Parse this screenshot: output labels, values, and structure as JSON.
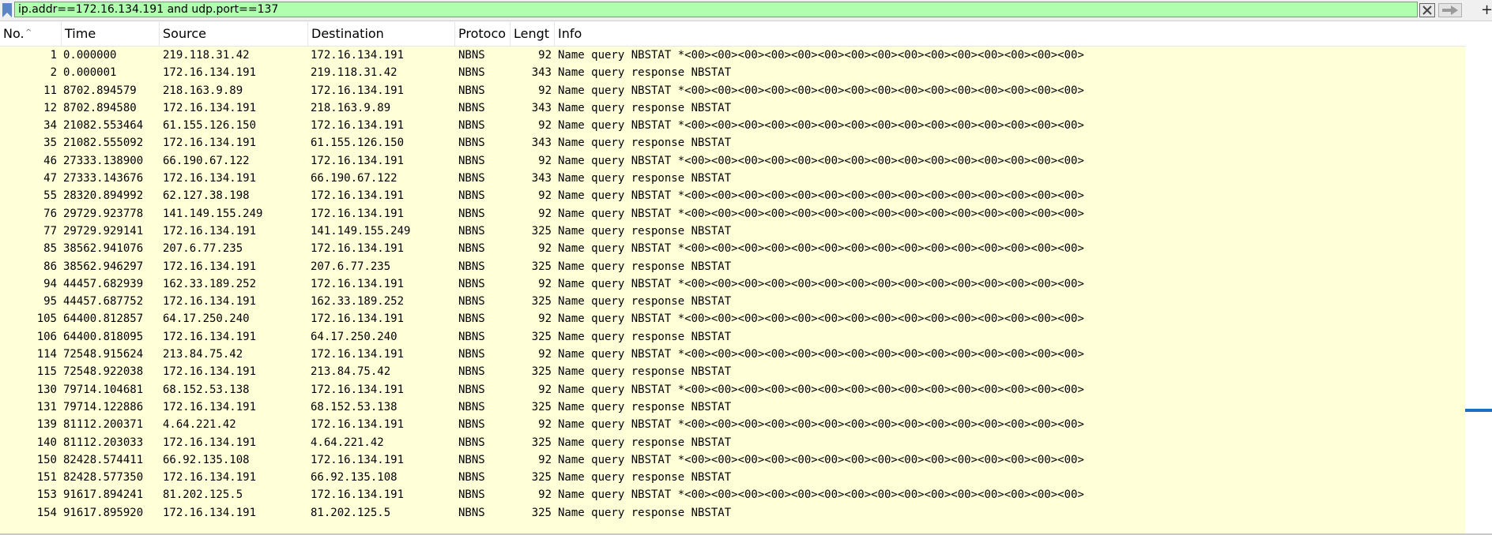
{
  "filter": {
    "value": "ip.addr==172.16.134.191 and udp.port==137",
    "plus_label": "+"
  },
  "columns": {
    "no": "No.",
    "time": "Time",
    "source": "Source",
    "destination": "Destination",
    "protocol": "Protoco",
    "length": "Lengt",
    "info": "Info"
  },
  "packets": [
    {
      "no": "1",
      "time": "0.000000",
      "src": "219.118.31.42",
      "dst": "172.16.134.191",
      "proto": "NBNS",
      "len": "92",
      "info": "Name query NBSTAT *<00><00><00><00><00><00><00><00><00><00><00><00><00><00><00>"
    },
    {
      "no": "2",
      "time": "0.000001",
      "src": "172.16.134.191",
      "dst": "219.118.31.42",
      "proto": "NBNS",
      "len": "343",
      "info": "Name query response NBSTAT"
    },
    {
      "no": "11",
      "time": "8702.894579",
      "src": "218.163.9.89",
      "dst": "172.16.134.191",
      "proto": "NBNS",
      "len": "92",
      "info": "Name query NBSTAT *<00><00><00><00><00><00><00><00><00><00><00><00><00><00><00>"
    },
    {
      "no": "12",
      "time": "8702.894580",
      "src": "172.16.134.191",
      "dst": "218.163.9.89",
      "proto": "NBNS",
      "len": "343",
      "info": "Name query response NBSTAT"
    },
    {
      "no": "34",
      "time": "21082.553464",
      "src": "61.155.126.150",
      "dst": "172.16.134.191",
      "proto": "NBNS",
      "len": "92",
      "info": "Name query NBSTAT *<00><00><00><00><00><00><00><00><00><00><00><00><00><00><00>"
    },
    {
      "no": "35",
      "time": "21082.555092",
      "src": "172.16.134.191",
      "dst": "61.155.126.150",
      "proto": "NBNS",
      "len": "343",
      "info": "Name query response NBSTAT"
    },
    {
      "no": "46",
      "time": "27333.138900",
      "src": "66.190.67.122",
      "dst": "172.16.134.191",
      "proto": "NBNS",
      "len": "92",
      "info": "Name query NBSTAT *<00><00><00><00><00><00><00><00><00><00><00><00><00><00><00>"
    },
    {
      "no": "47",
      "time": "27333.143676",
      "src": "172.16.134.191",
      "dst": "66.190.67.122",
      "proto": "NBNS",
      "len": "343",
      "info": "Name query response NBSTAT"
    },
    {
      "no": "55",
      "time": "28320.894992",
      "src": "62.127.38.198",
      "dst": "172.16.134.191",
      "proto": "NBNS",
      "len": "92",
      "info": "Name query NBSTAT *<00><00><00><00><00><00><00><00><00><00><00><00><00><00><00>"
    },
    {
      "no": "76",
      "time": "29729.923778",
      "src": "141.149.155.249",
      "dst": "172.16.134.191",
      "proto": "NBNS",
      "len": "92",
      "info": "Name query NBSTAT *<00><00><00><00><00><00><00><00><00><00><00><00><00><00><00>"
    },
    {
      "no": "77",
      "time": "29729.929141",
      "src": "172.16.134.191",
      "dst": "141.149.155.249",
      "proto": "NBNS",
      "len": "325",
      "info": "Name query response NBSTAT"
    },
    {
      "no": "85",
      "time": "38562.941076",
      "src": "207.6.77.235",
      "dst": "172.16.134.191",
      "proto": "NBNS",
      "len": "92",
      "info": "Name query NBSTAT *<00><00><00><00><00><00><00><00><00><00><00><00><00><00><00>"
    },
    {
      "no": "86",
      "time": "38562.946297",
      "src": "172.16.134.191",
      "dst": "207.6.77.235",
      "proto": "NBNS",
      "len": "325",
      "info": "Name query response NBSTAT"
    },
    {
      "no": "94",
      "time": "44457.682939",
      "src": "162.33.189.252",
      "dst": "172.16.134.191",
      "proto": "NBNS",
      "len": "92",
      "info": "Name query NBSTAT *<00><00><00><00><00><00><00><00><00><00><00><00><00><00><00>"
    },
    {
      "no": "95",
      "time": "44457.687752",
      "src": "172.16.134.191",
      "dst": "162.33.189.252",
      "proto": "NBNS",
      "len": "325",
      "info": "Name query response NBSTAT"
    },
    {
      "no": "105",
      "time": "64400.812857",
      "src": "64.17.250.240",
      "dst": "172.16.134.191",
      "proto": "NBNS",
      "len": "92",
      "info": "Name query NBSTAT *<00><00><00><00><00><00><00><00><00><00><00><00><00><00><00>"
    },
    {
      "no": "106",
      "time": "64400.818095",
      "src": "172.16.134.191",
      "dst": "64.17.250.240",
      "proto": "NBNS",
      "len": "325",
      "info": "Name query response NBSTAT"
    },
    {
      "no": "114",
      "time": "72548.915624",
      "src": "213.84.75.42",
      "dst": "172.16.134.191",
      "proto": "NBNS",
      "len": "92",
      "info": "Name query NBSTAT *<00><00><00><00><00><00><00><00><00><00><00><00><00><00><00>"
    },
    {
      "no": "115",
      "time": "72548.922038",
      "src": "172.16.134.191",
      "dst": "213.84.75.42",
      "proto": "NBNS",
      "len": "325",
      "info": "Name query response NBSTAT"
    },
    {
      "no": "130",
      "time": "79714.104681",
      "src": "68.152.53.138",
      "dst": "172.16.134.191",
      "proto": "NBNS",
      "len": "92",
      "info": "Name query NBSTAT *<00><00><00><00><00><00><00><00><00><00><00><00><00><00><00>"
    },
    {
      "no": "131",
      "time": "79714.122886",
      "src": "172.16.134.191",
      "dst": "68.152.53.138",
      "proto": "NBNS",
      "len": "325",
      "info": "Name query response NBSTAT"
    },
    {
      "no": "139",
      "time": "81112.200371",
      "src": "4.64.221.42",
      "dst": "172.16.134.191",
      "proto": "NBNS",
      "len": "92",
      "info": "Name query NBSTAT *<00><00><00><00><00><00><00><00><00><00><00><00><00><00><00>"
    },
    {
      "no": "140",
      "time": "81112.203033",
      "src": "172.16.134.191",
      "dst": "4.64.221.42",
      "proto": "NBNS",
      "len": "325",
      "info": "Name query response NBSTAT"
    },
    {
      "no": "150",
      "time": "82428.574411",
      "src": "66.92.135.108",
      "dst": "172.16.134.191",
      "proto": "NBNS",
      "len": "92",
      "info": "Name query NBSTAT *<00><00><00><00><00><00><00><00><00><00><00><00><00><00><00>"
    },
    {
      "no": "151",
      "time": "82428.577350",
      "src": "172.16.134.191",
      "dst": "66.92.135.108",
      "proto": "NBNS",
      "len": "325",
      "info": "Name query response NBSTAT"
    },
    {
      "no": "153",
      "time": "91617.894241",
      "src": "81.202.125.5",
      "dst": "172.16.134.191",
      "proto": "NBNS",
      "len": "92",
      "info": "Name query NBSTAT *<00><00><00><00><00><00><00><00><00><00><00><00><00><00><00>"
    },
    {
      "no": "154",
      "time": "91617.895920",
      "src": "172.16.134.191",
      "dst": "81.202.125.5",
      "proto": "NBNS",
      "len": "325",
      "info": "Name query response NBSTAT"
    }
  ],
  "colors": {
    "filter_valid_bg": "#afffaf",
    "row_bg": "#ffffd8",
    "scroll_marker": "#1f6fc5"
  }
}
